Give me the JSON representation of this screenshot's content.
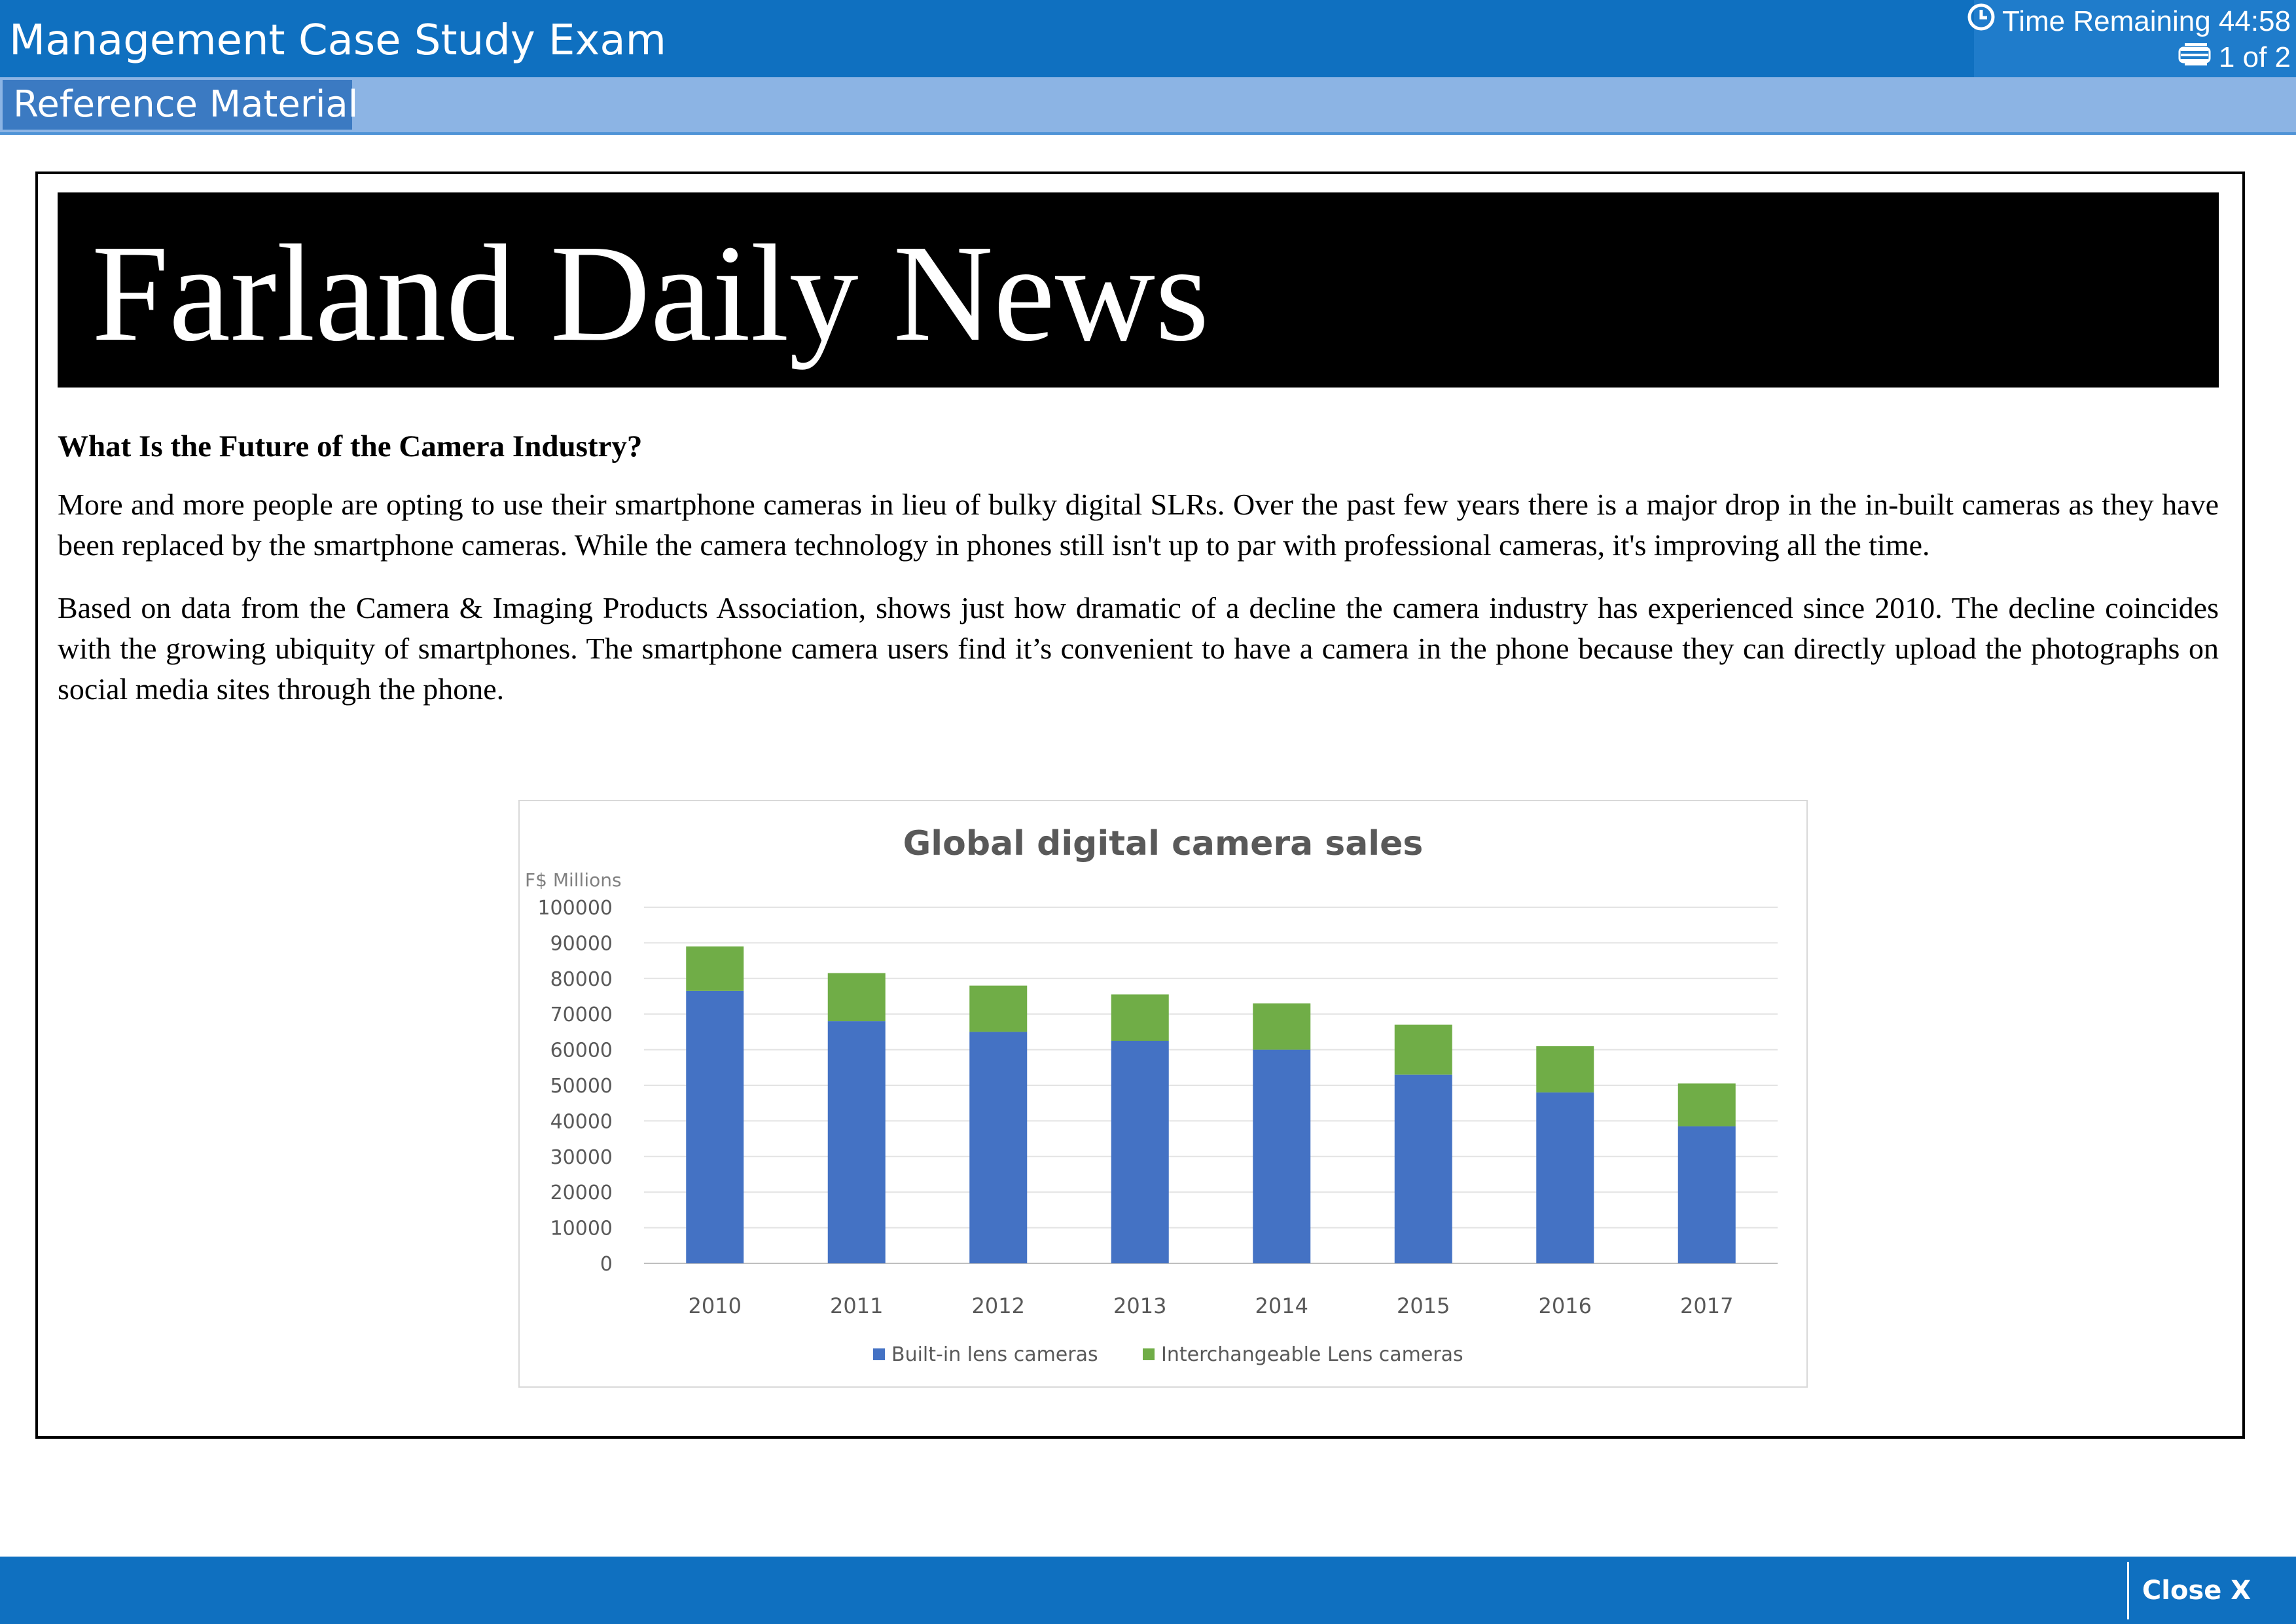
{
  "header": {
    "exam_title": "Management Case Study Exam",
    "timer_label": "Time Remaining 44:58",
    "page_indicator": "1 of 2",
    "timer_icon": "clock-icon",
    "page_icon": "pages-icon",
    "bar_color": "#0f70c0"
  },
  "subheader": {
    "tab_label": "Reference Material",
    "bar_color": "#8cb4e4"
  },
  "article": {
    "masthead": "Farland Daily News",
    "heading": "What Is the Future of the Camera Industry?",
    "paragraphs": [
      "More and more people are opting to use their smartphone cameras in lieu of bulky digital SLRs. Over the past few years there is a major drop in the in-built cameras as they have been replaced by the smartphone cameras. While the camera technology in phones still isn't up to par with professional cameras, it's improving all the time.",
      "Based on data from the Camera & Imaging Products Association, shows just how dramatic of a decline the camera industry has experienced since 2010. The decline coincides with the growing ubiquity of smartphones. The smartphone camera users find it’s convenient to have a camera in the phone because they can directly upload the photographs on social media sites through the phone."
    ]
  },
  "chart_data": {
    "type": "bar",
    "stacked": true,
    "title": "Global digital camera sales",
    "ylabel": "F$ Millions",
    "xlabel": "",
    "ylim": [
      0,
      100000
    ],
    "yticks": [
      0,
      10000,
      20000,
      30000,
      40000,
      50000,
      60000,
      70000,
      80000,
      90000,
      100000
    ],
    "categories": [
      "2010",
      "2011",
      "2012",
      "2013",
      "2014",
      "2015",
      "2016",
      "2017"
    ],
    "series": [
      {
        "name": "Built-in lens cameras",
        "color": "#4472c4",
        "values": [
          76500,
          68000,
          65000,
          62500,
          60000,
          53000,
          48000,
          38500
        ]
      },
      {
        "name": "Interchangeable Lens cameras",
        "color": "#70ad47",
        "values": [
          12500,
          13500,
          13000,
          13000,
          13000,
          14000,
          13000,
          12000
        ]
      }
    ],
    "grid": true,
    "legend_position": "bottom"
  },
  "footer": {
    "close_label": "Close X"
  }
}
